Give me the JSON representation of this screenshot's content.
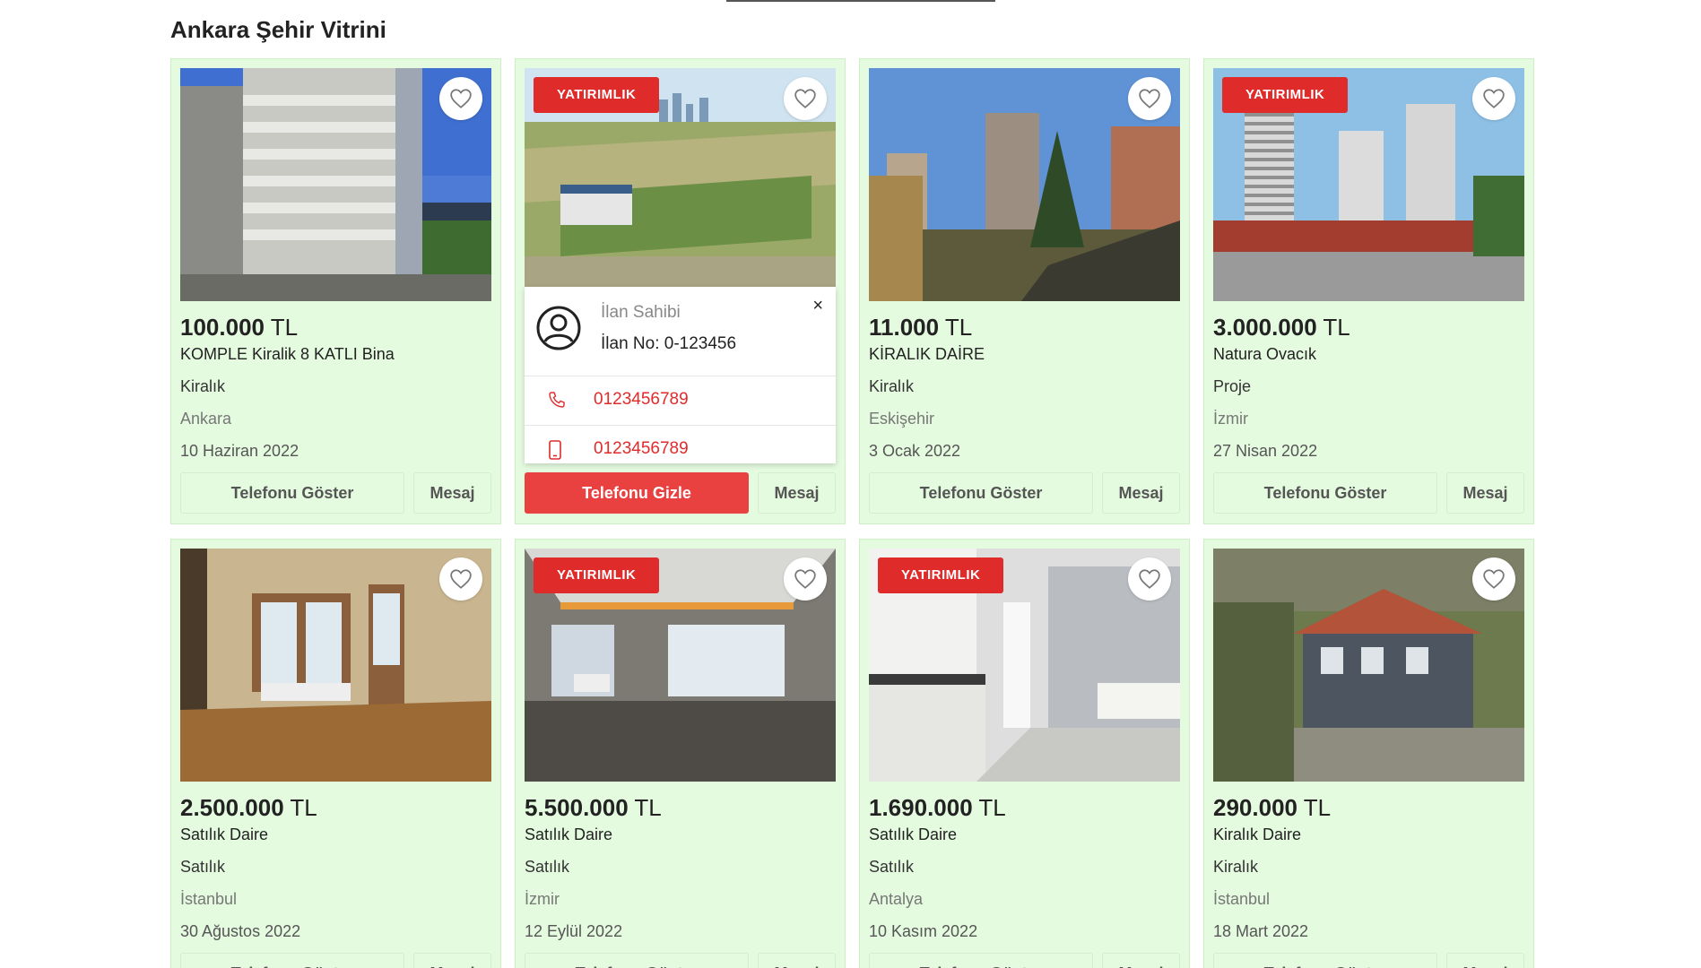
{
  "section": {
    "title_bold": "Ankara",
    "title_rest": " Şehir Vitrini"
  },
  "ui": {
    "favorite_icon": "heart-icon",
    "owner_icon": "user-circle-icon",
    "phone_icon": "phone-icon",
    "mobile_icon": "mobile-icon",
    "close_icon": "close-icon",
    "accent": "#e02b2b",
    "card_bg": "#e5fbe0"
  },
  "popup": {
    "owner_label": "İlan Sahibi",
    "listing_no": "İlan No: 0-123456",
    "close": "×",
    "phone": "0123456789",
    "mobile": "0123456789"
  },
  "listings": [
    {
      "badge": "",
      "price_amount": "100.000",
      "price_currency": " TL",
      "title": "KOMPLE Kiralik 8 KATLI Bina",
      "type": "Kiralık",
      "city": "Ankara",
      "date": "10 Haziran 2022",
      "phone_btn": "Telefonu Göster",
      "msg_btn": "Mesaj"
    },
    {
      "badge": "YATIRIMLIK",
      "price_amount": "",
      "price_currency": "",
      "title": "",
      "type": "",
      "city": "",
      "date": "",
      "phone_btn": "Telefonu Gizle",
      "msg_btn": "Mesaj"
    },
    {
      "badge": "",
      "price_amount": "11.000",
      "price_currency": " TL",
      "title": "KİRALIK DAİRE",
      "type": "Kiralık",
      "city": "Eskişehir",
      "date": "3 Ocak 2022",
      "phone_btn": "Telefonu Göster",
      "msg_btn": "Mesaj"
    },
    {
      "badge": "YATIRIMLIK",
      "price_amount": "3.000.000",
      "price_currency": " TL",
      "title": "Natura Ovacık",
      "type": "Proje",
      "city": "İzmir",
      "date": "27 Nisan 2022",
      "phone_btn": "Telefonu Göster",
      "msg_btn": "Mesaj"
    },
    {
      "badge": "",
      "price_amount": "2.500.000",
      "price_currency": " TL",
      "title": "Satılık Daire",
      "type": "Satılık",
      "city": "İstanbul",
      "date": "30 Ağustos 2022",
      "phone_btn": "Telefonu Göster",
      "msg_btn": "Mesaj"
    },
    {
      "badge": "YATIRIMLIK",
      "price_amount": "5.500.000",
      "price_currency": " TL",
      "title": "Satılık Daire",
      "type": "Satılık",
      "city": "İzmir",
      "date": "12 Eylül 2022",
      "phone_btn": "Telefonu Göster",
      "msg_btn": "Mesaj"
    },
    {
      "badge": "YATIRIMLIK",
      "price_amount": "1.690.000",
      "price_currency": " TL",
      "title": "Satılık Daire",
      "type": "Satılık",
      "city": "Antalya",
      "date": "10 Kasım 2022",
      "phone_btn": "Telefonu Göster",
      "msg_btn": "Mesaj"
    },
    {
      "badge": "",
      "price_amount": "290.000",
      "price_currency": " TL",
      "title": "Kiralık Daire",
      "type": "Kiralık",
      "city": "İstanbul",
      "date": "18 Mart 2022",
      "phone_btn": "Telefonu Göster",
      "msg_btn": "Mesaj"
    }
  ]
}
